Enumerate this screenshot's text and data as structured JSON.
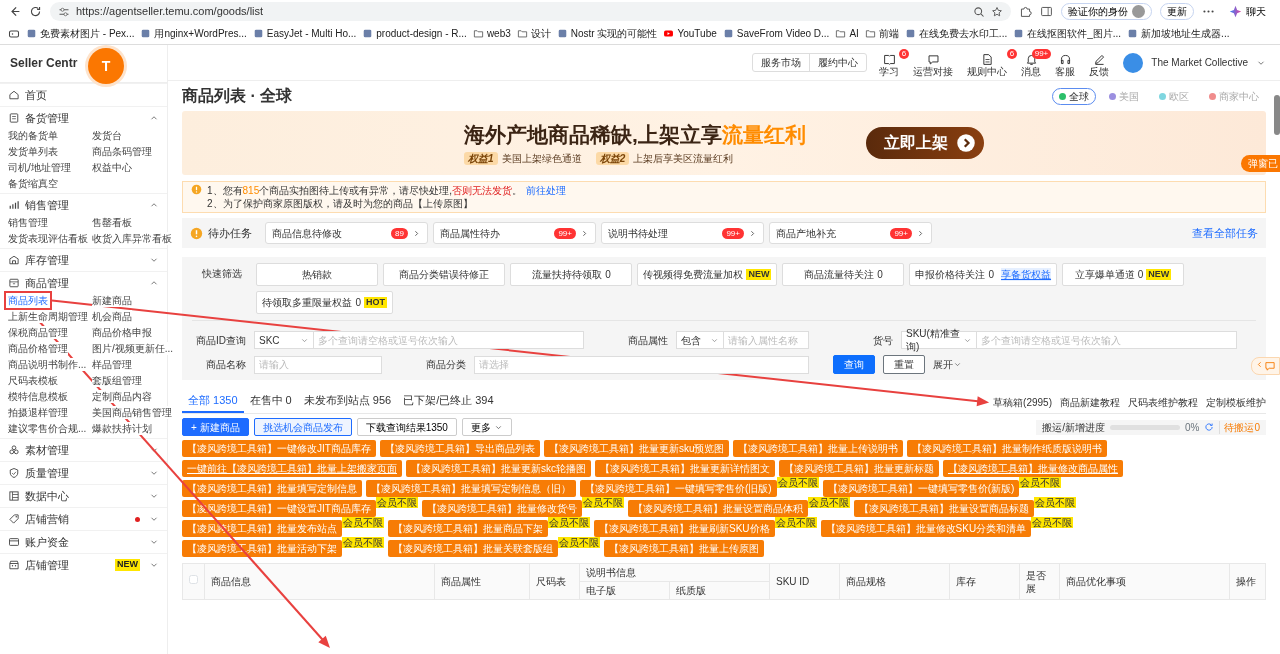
{
  "browser": {
    "url": "https://agentseller.temu.com/goods/list",
    "profile_button": "验证你的身份",
    "update_button": "更新",
    "chat_button": "聊天",
    "bookmarks": [
      {
        "label": "免费素材图片 - Pex...",
        "kind": "site"
      },
      {
        "label": "用nginx+WordPres...",
        "kind": "site"
      },
      {
        "label": "EasyJet - Multi Ho...",
        "kind": "site"
      },
      {
        "label": "product-design - R...",
        "kind": "site"
      },
      {
        "label": "web3",
        "kind": "folder"
      },
      {
        "label": "设计",
        "kind": "folder"
      },
      {
        "label": "Nostr 实现的可能性",
        "kind": "site"
      },
      {
        "label": "YouTube",
        "kind": "video"
      },
      {
        "label": "SaveFrom Video D...",
        "kind": "site"
      },
      {
        "label": "AI",
        "kind": "folder"
      },
      {
        "label": "前端",
        "kind": "folder"
      },
      {
        "label": "在线免费去水印工...",
        "kind": "site"
      },
      {
        "label": "在线抠图软件_图片...",
        "kind": "site"
      },
      {
        "label": "新加坡地址生成器...",
        "kind": "site"
      }
    ]
  },
  "sidebar": {
    "title": "Seller Centr",
    "logo_letter": "T",
    "sections": [
      {
        "label": "首页"
      },
      {
        "label": "备货管理",
        "expanded": true,
        "items": [
          {
            "label": "我的备货单",
            "selected": false
          },
          {
            "label": "发货台",
            "selected": false
          },
          {
            "label": "发货单列表",
            "selected": false
          },
          {
            "label": "商品条码管理",
            "selected": false
          },
          {
            "label": "司机/地址管理",
            "selected": false
          },
          {
            "label": "权益中心",
            "selected": false
          },
          {
            "label": "备货缩真空",
            "selected": false
          }
        ]
      },
      {
        "label": "销售管理",
        "expanded": true,
        "items": [
          {
            "label": "销售管理",
            "selected": false
          },
          {
            "label": "售罄看板",
            "selected": false
          },
          {
            "label": "发货表现评估看板",
            "selected": false
          },
          {
            "label": "收货入库异常看板",
            "selected": false
          }
        ]
      },
      {
        "label": "库存管理",
        "expanded": false
      },
      {
        "label": "商品管理",
        "expanded": true,
        "items": [
          {
            "label": "商品列表",
            "selected": true
          },
          {
            "label": "新建商品",
            "selected": false
          },
          {
            "label": "上新生命周期管理",
            "selected": false
          },
          {
            "label": "机会商品",
            "selected": false
          },
          {
            "label": "保税商品管理",
            "selected": false
          },
          {
            "label": "商品价格申报",
            "selected": false
          },
          {
            "label": "商品价格管理",
            "selected": false
          },
          {
            "label": "图片/视频更新任...",
            "selected": false
          },
          {
            "label": "商品说明书制作...",
            "selected": false
          },
          {
            "label": "样品管理",
            "selected": false
          },
          {
            "label": "尺码表模板",
            "selected": false
          },
          {
            "label": "套版组管理",
            "selected": false
          },
          {
            "label": "模特信息模板",
            "selected": false
          },
          {
            "label": "定制商品内容",
            "selected": false
          },
          {
            "label": "拍摄退样管理",
            "selected": false
          },
          {
            "label": "美国商品销售管理",
            "selected": false
          },
          {
            "label": "建议零售价合规...",
            "selected": false
          },
          {
            "label": "爆款扶持计划",
            "selected": false
          }
        ]
      },
      {
        "label": "素材管理",
        "expanded": false
      },
      {
        "label": "质量管理",
        "expanded": false
      },
      {
        "label": "数据中心",
        "expanded": false
      },
      {
        "label": "店铺营销",
        "expanded": false,
        "alert_dot": true
      },
      {
        "label": "账户资金",
        "expanded": false
      },
      {
        "label": "店铺管理",
        "expanded": false,
        "badge": "NEW"
      }
    ]
  },
  "header": {
    "top_links": [
      "服务市场",
      "履约中心"
    ],
    "tools": [
      {
        "label": "学习",
        "badge": "6"
      },
      {
        "label": "运营对接"
      },
      {
        "label": "规则中心",
        "badge": "6"
      },
      {
        "label": "消息",
        "badge": "99+"
      },
      {
        "label": "客服"
      },
      {
        "label": "反馈"
      }
    ],
    "user": "The Market Collective"
  },
  "page": {
    "title": "商品列表 · 全球",
    "side_tab": "弹窗已",
    "regions": [
      {
        "label": "全球",
        "color": "#2bbf6a",
        "selected": true
      },
      {
        "label": "美国",
        "color": "#9b8fe0",
        "selected": false
      },
      {
        "label": "欧区",
        "color": "#7fd6e0",
        "selected": false
      },
      {
        "label": "商家中心",
        "color": "#f08c8c",
        "selected": false
      }
    ]
  },
  "banner": {
    "headline": "海外产地商品稀缺,上架立享",
    "highlight": "流量红利",
    "perks": [
      {
        "tag": "权益1",
        "text": "美国上架绿色通道"
      },
      {
        "tag": "权益2",
        "text": "上架后享美区流量红利"
      }
    ],
    "button": "立即上架"
  },
  "notice": {
    "lines": [
      [
        {
          "text": "1、您有"
        },
        {
          "text": "815",
          "kind": "count"
        },
        {
          "text": "个商品实拍图待上传或有异常，请尽快处理,"
        },
        {
          "text": "否则无法发货",
          "kind": "alert"
        },
        {
          "text": "。"
        },
        {
          "text": "前往处理",
          "kind": "link"
        }
      ],
      [
        {
          "text": "2、为了保护商家原图版权，请及时为您的商品【上传原图】"
        }
      ]
    ]
  },
  "tasks": {
    "label": "待办任务",
    "items": [
      {
        "label": "商品信息待修改",
        "count": "89"
      },
      {
        "label": "商品属性待办",
        "count": "99+"
      },
      {
        "label": "说明书待处理",
        "count": "99+"
      },
      {
        "label": "商品产地补充",
        "count": "99+"
      }
    ],
    "link": "查看全部任务"
  },
  "quick_filter": {
    "label": "快速筛选",
    "chips": [
      {
        "label": "热销款"
      },
      {
        "label": "商品分类错误待修正"
      },
      {
        "label": "流量扶持待领取",
        "count": "0"
      },
      {
        "label": "传视频得免费流量加权",
        "badge": "NEW"
      },
      {
        "label": "商品流量待关注",
        "count": "0"
      },
      {
        "label": "申报价格待关注",
        "count": "0",
        "link": "享备货权益"
      },
      {
        "label": "立享爆单通道",
        "count": "0",
        "badge": "NEW"
      },
      {
        "label": "待领取多重限量权益",
        "count": "0",
        "badge": "HOT"
      }
    ]
  },
  "search": {
    "fields": [
      {
        "label": "商品ID查询",
        "select": "SKC",
        "placeholder": "多个查询请空格或逗号依次输入"
      },
      {
        "label": "商品属性",
        "select": "包含",
        "placeholder": "请输入属性名称"
      },
      {
        "label": "货号",
        "select": "SKU(精准查询)",
        "placeholder": "多个查询请空格或逗号依次输入"
      },
      {
        "label": "商品名称",
        "placeholder": "请输入"
      },
      {
        "label": "商品分类",
        "placeholder": "请选择"
      }
    ],
    "query_button": "查询",
    "reset_button": "重置",
    "expand_link": "展开"
  },
  "tabs": [
    {
      "label": "全部 1350",
      "selected": true
    },
    {
      "label": "在售中 0",
      "selected": false
    },
    {
      "label": "未发布到站点 956",
      "selected": false
    },
    {
      "label": "已下架/已终止 394",
      "selected": false
    }
  ],
  "links": [
    "草稿箱(2995)",
    "商品新建教程",
    "尺码表维护教程",
    "定制模板维护"
  ],
  "actions": [
    {
      "label": "+ 新建商品",
      "kind": "primary"
    },
    {
      "label": "挑选机会商品发布",
      "kind": "outline"
    },
    {
      "label": "下载查询结果1350",
      "kind": "plain"
    },
    {
      "label": "更多",
      "kind": "dropdown"
    }
  ],
  "progress": {
    "label": "搬运/新增进度",
    "level": 0,
    "reading": "0%",
    "pending": "待搬运0"
  },
  "tools": [
    {
      "label": "【凌风跨境工具箱】一键修改JIT商品库存"
    },
    {
      "label": "【凌风跨境工具箱】导出商品列表"
    },
    {
      "label": "【凌风跨境工具箱】批量更新sku预览图"
    },
    {
      "label": "【凌风跨境工具箱】批量上传说明书"
    },
    {
      "label": "【凌风跨境工具箱】批量制作纸质版说明书"
    },
    {
      "label": "一键前往【凌风跨境工具箱】批量上架搬家页面",
      "underlined": true
    },
    {
      "label": "【凌风跨境工具箱】批量更新skc轮播图"
    },
    {
      "label": "【凌风跨境工具箱】批量更新详情图文"
    },
    {
      "label": "【凌风跨境工具箱】批量更新标题"
    },
    {
      "label": "【凌风跨境工具箱】批量修改商品属性",
      "underlined": true
    },
    {
      "label": "【凌风跨境工具箱】批量填写定制信息"
    },
    {
      "label": "【凌风跨境工具箱】批量填写定制信息（旧）"
    },
    {
      "label": "【凌风跨境工具箱】一键填写零售价(旧版)",
      "member_badge": "会员不限"
    },
    {
      "label": "【凌风跨境工具箱】一键填写零售价(新版)",
      "member_badge": "会员不限"
    },
    {
      "label": "【凌风跨境工具箱】一键设置JIT商品库存",
      "member_badge": "会员不限"
    },
    {
      "label": "【凌风跨境工具箱】批量修改货号",
      "member_badge": "会员不限"
    },
    {
      "label": "【凌风跨境工具箱】批量设置商品体积",
      "member_badge": "会员不限"
    },
    {
      "label": "【凌风跨境工具箱】批量设置商品标题",
      "member_badge": "会员不限"
    },
    {
      "label": "【凌风跨境工具箱】批量发布站点",
      "member_badge": "会员不限"
    },
    {
      "label": "【凌风跨境工具箱】批量商品下架",
      "member_badge": "会员不限"
    },
    {
      "label": "【凌风跨境工具箱】批量刷新SKU价格",
      "member_badge": "会员不限"
    },
    {
      "label": "【凌风跨境工具箱】批量修改SKU分类和清单",
      "member_badge": "会员不限"
    },
    {
      "label": "【凌风跨境工具箱】批量活动下架",
      "member_badge": "会员不限"
    },
    {
      "label": "【凌风跨境工具箱】批量关联套版组",
      "member_badge": "会员不限"
    },
    {
      "label": "【凌风跨境工具箱】批量上传原图"
    }
  ],
  "table": {
    "select_all": {
      "checked": false
    },
    "columns": [
      "商品信息",
      "商品属性",
      "尺码表",
      "说明书信息",
      "SKU ID",
      "商品规格",
      "库存",
      "是否展",
      "商品优化事项",
      "操作"
    ],
    "subcolumns": [
      "电子版",
      "纸质版"
    ]
  }
}
